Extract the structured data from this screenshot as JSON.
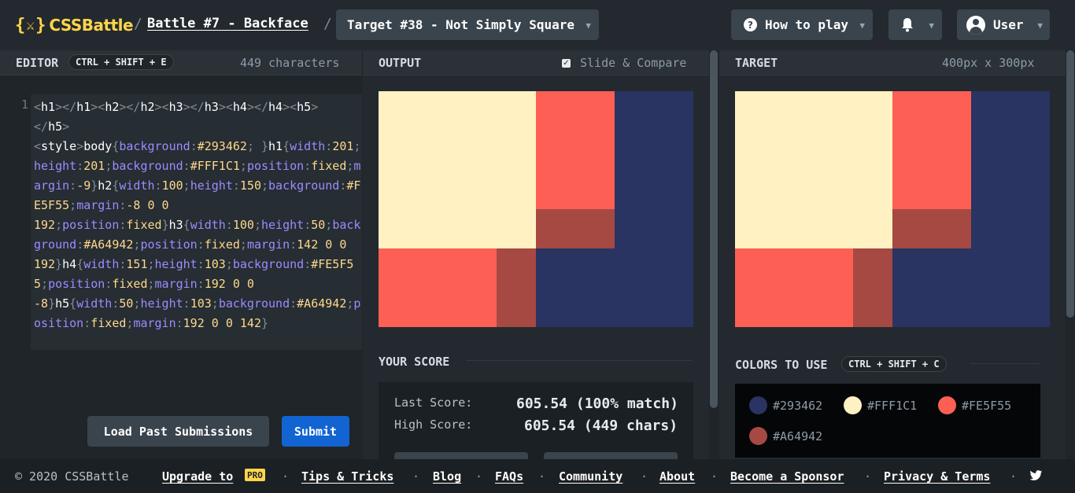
{
  "header": {
    "brand": "CSSBattle",
    "brand_brace_open": "{",
    "brand_brace_close": "}",
    "battle_link": "Battle #7 - Backface",
    "target_select": "Target #38 - Not Simply Square",
    "howto_label": "How to play",
    "user_label": "User",
    "separator": "/"
  },
  "editor": {
    "title": "EDITOR",
    "shortcut": "CTRL + SHIFT + E",
    "char_count": "449 characters",
    "line_number": "1",
    "load_button": "Load Past Submissions",
    "submit_button": "Submit"
  },
  "output": {
    "title": "OUTPUT",
    "slide_compare_label": "Slide & Compare",
    "slide_compare_checked": true
  },
  "score": {
    "title": "YOUR SCORE",
    "last_label": "Last Score:",
    "last_value": "605.54 (100% match)",
    "high_label": "High Score:",
    "high_value": "605.54 (449 chars)"
  },
  "target": {
    "title": "TARGET",
    "dimensions": "400px x 300px"
  },
  "colors": {
    "title": "COLORS TO USE",
    "shortcut": "CTRL + SHIFT + C",
    "items": [
      {
        "hex": "#293462",
        "label": "#293462"
      },
      {
        "hex": "#FFF1C1",
        "label": "#FFF1C1"
      },
      {
        "hex": "#FE5F55",
        "label": "#FE5F55"
      },
      {
        "hex": "#A64942",
        "label": "#A64942"
      }
    ]
  },
  "footer": {
    "copyright": "© 2020 CSSBattle",
    "upgrade": "Upgrade to",
    "pro": "PRO",
    "tips": "Tips & Tricks",
    "blog": "Blog",
    "faqs": "FAQs",
    "community": "Community",
    "about": "About",
    "sponsor": "Become a Sponsor",
    "privacy": "Privacy & Terms",
    "dot": "·"
  },
  "theme": {
    "accent": "#ffd54a",
    "submit": "#1264d3"
  }
}
